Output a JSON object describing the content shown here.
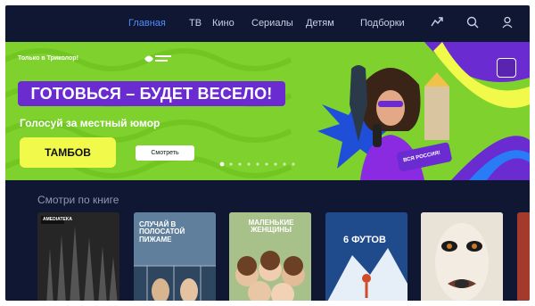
{
  "nav": {
    "items": [
      {
        "label": "Главная",
        "active": true
      },
      {
        "label": "ТВ",
        "active": false
      },
      {
        "label": "Кино",
        "active": false
      },
      {
        "label": "Сериалы",
        "active": false
      },
      {
        "label": "Детям",
        "active": false
      },
      {
        "label": "Подборки",
        "active": false
      }
    ],
    "icons": [
      "cast-icon",
      "search-icon",
      "profile-icon"
    ]
  },
  "banner": {
    "promo_label": "Только в Триколор!",
    "partner_logo": "Открытый микрофон",
    "headline": "ГОТОВЬСЯ – БУДЕТ ВЕСЕЛО!",
    "subline": "Голосуй за местный юмор",
    "city_button": "ТАМБОВ",
    "watch_button": "Смотреть",
    "sticker": "ВСЯ РОССИЯ!",
    "colors": {
      "background": "#7fd12d",
      "headline_bg": "#6a2bd1",
      "city_btn": "#f1f94a"
    },
    "carousel": {
      "count": 9,
      "active_index": 0
    }
  },
  "shelf": {
    "title": "Смотри по книге",
    "posters": [
      {
        "badge": "AMEDIATEKA",
        "title": ""
      },
      {
        "title": "СЛУЧАЙ В ПОЛОСАТОЙ ПИЖАМЕ"
      },
      {
        "title": "МАЛЕНЬКИЕ ЖЕНЩИНЫ"
      },
      {
        "title": "6 ФУТОВ"
      },
      {
        "title": ""
      },
      {
        "title": ""
      }
    ]
  }
}
